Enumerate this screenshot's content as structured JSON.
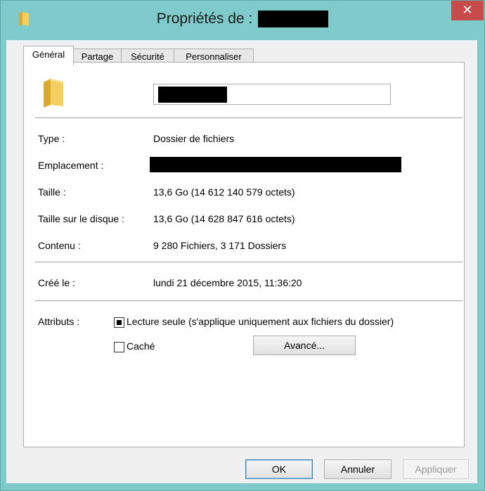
{
  "window": {
    "title": "Propriétés de :",
    "close_glyph": "✕"
  },
  "tabs": [
    {
      "label": "Général",
      "active": true
    },
    {
      "label": "Partage",
      "active": false
    },
    {
      "label": "Sécurité",
      "active": false
    },
    {
      "label": "Personnaliser",
      "active": false
    }
  ],
  "general": {
    "rows": [
      {
        "label": "Type :",
        "value": "Dossier de fichiers"
      },
      {
        "label": "Emplacement :",
        "value": ""
      },
      {
        "label": "Taille :",
        "value": "13,6 Go (14 612 140 579 octets)"
      },
      {
        "label": "Taille sur le disque :",
        "value": "13,6 Go (14 628 847 616 octets)"
      },
      {
        "label": "Contenu :",
        "value": "9 280 Fichiers, 3 171 Dossiers"
      }
    ],
    "created_label": "Créé le :",
    "created_value": "lundi 21 décembre 2015, 11:36:20",
    "attributes_label": "Attributs :",
    "readonly_label": "Lecture seule (s'applique uniquement aux fichiers du dossier)",
    "readonly_checked": true,
    "hidden_label": "Caché",
    "hidden_checked": false,
    "advanced_button": "Avancé..."
  },
  "buttons": {
    "ok": "OK",
    "cancel": "Annuler",
    "apply": "Appliquer"
  },
  "icons": {
    "title": "folder-icon",
    "big": "folder-icon",
    "close": "close-icon"
  },
  "colors": {
    "frame": "#7fcbcb",
    "close": "#c74b4b",
    "folder": "#e8c24a"
  }
}
